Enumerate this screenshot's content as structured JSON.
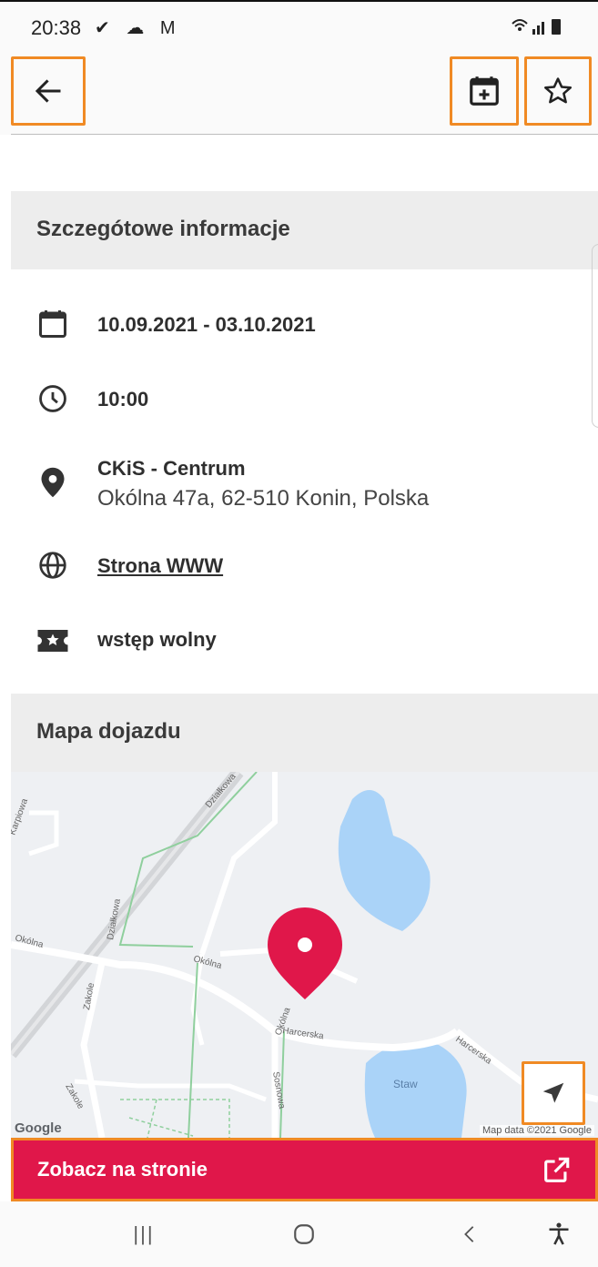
{
  "status_bar": {
    "time": "20:38",
    "left_icons": "✔ ☁ M",
    "right_icons": "wifi-signal-battery"
  },
  "app_bar": {
    "back": "back-arrow-icon",
    "add_calendar": "calendar-plus-icon",
    "favorite": "star-outline-icon"
  },
  "details": {
    "title": "Szczegótowe informacje",
    "date": "10.09.2021 - 03.10.2021",
    "time": "10:00",
    "venue_name": "CKiS - Centrum",
    "venue_address": "Okólna 47a, 62-510 Konin, Polska",
    "website_label": "Strona WWW",
    "ticket_info": "wstęp wolny"
  },
  "map": {
    "title": "Mapa dojazdu",
    "attribution": "Map data ©2021 Google",
    "logo": "Google",
    "street_labels": [
      "Działkowa",
      "Karpiowa",
      "Okólna",
      "Działkowa",
      "Zakole",
      "Okólna",
      "Okólna",
      "Harcerska",
      "Sosnowa",
      "Harcerska",
      "Staw",
      "Zakole"
    ],
    "pin_color": "#e0174a"
  },
  "cta": {
    "label": "Zobacz na stronie",
    "color": "#e0174a"
  },
  "nav": {
    "recents": "|||",
    "home": "◯",
    "back": "‹",
    "accessibility": "accessibility-icon"
  }
}
